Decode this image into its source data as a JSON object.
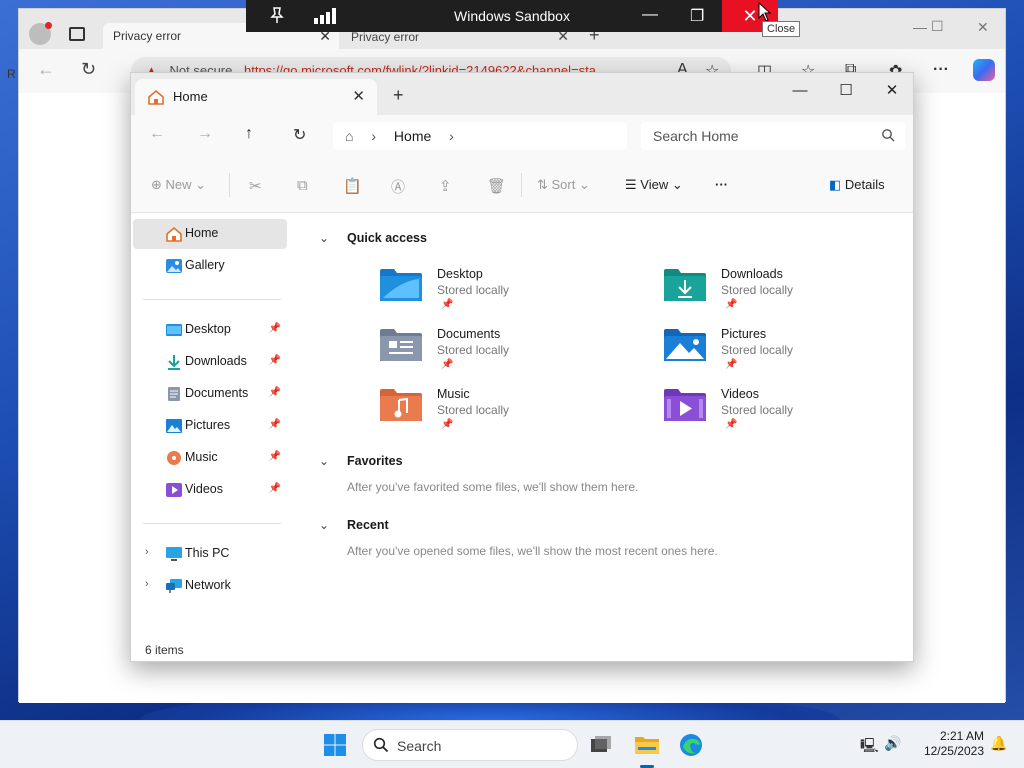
{
  "browser": {
    "tab1_title": "Privacy error",
    "tab2_title": "Privacy error",
    "not_secure": "Not secure",
    "url": "https://go.microsoft.com/fwlink/?linkid=2149622&channel=sta...",
    "left_edge_letter": "R"
  },
  "sandbox": {
    "title": "Windows Sandbox",
    "close_tooltip": "Close"
  },
  "explorer": {
    "tab_title": "Home",
    "breadcrumb": "Home",
    "search_placeholder": "Search Home",
    "commands": {
      "new": "New",
      "sort": "Sort",
      "view": "View",
      "more": "···",
      "details": "Details"
    },
    "sidebar": {
      "top": [
        {
          "label": "Home",
          "icon": "home-icon",
          "selected": true
        },
        {
          "label": "Gallery",
          "icon": "gallery-icon"
        }
      ],
      "pinned": [
        {
          "label": "Desktop",
          "icon": "desktop-folder-icon"
        },
        {
          "label": "Downloads",
          "icon": "downloads-folder-icon"
        },
        {
          "label": "Documents",
          "icon": "documents-folder-icon"
        },
        {
          "label": "Pictures",
          "icon": "pictures-folder-icon"
        },
        {
          "label": "Music",
          "icon": "music-folder-icon"
        },
        {
          "label": "Videos",
          "icon": "videos-folder-icon"
        }
      ],
      "locations": [
        {
          "label": "This PC",
          "icon": "this-pc-icon"
        },
        {
          "label": "Network",
          "icon": "network-icon"
        }
      ]
    },
    "sections": {
      "quick_access": "Quick access",
      "favorites": "Favorites",
      "favorites_hint": "After you've favorited some files, we'll show them here.",
      "recent": "Recent",
      "recent_hint": "After you've opened some files, we'll show the most recent ones here."
    },
    "quick_access": [
      {
        "name": "Desktop",
        "sub": "Stored locally",
        "color": "#1f8fe0"
      },
      {
        "name": "Downloads",
        "sub": "Stored locally",
        "color": "#1aa39a"
      },
      {
        "name": "Documents",
        "sub": "Stored locally",
        "color": "#8a97ad"
      },
      {
        "name": "Pictures",
        "sub": "Stored locally",
        "color": "#1a7fd6"
      },
      {
        "name": "Music",
        "sub": "Stored locally",
        "color": "#ea7b4f"
      },
      {
        "name": "Videos",
        "sub": "Stored locally",
        "color": "#8a4fd6"
      }
    ],
    "status": "6 items"
  },
  "taskbar": {
    "search_label": "Search",
    "time": "2:21 AM",
    "date": "12/25/2023"
  }
}
